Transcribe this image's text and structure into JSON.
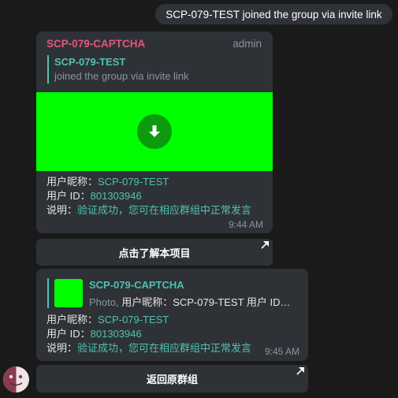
{
  "service_message": "SCP-079-TEST joined the group via invite link",
  "message1": {
    "sender": "SCP-079-CAPTCHA",
    "role": "admin",
    "quote_title": "SCP-079-TEST",
    "quote_subtitle": "joined the group via invite link",
    "line1_label": "用户昵称：",
    "line1_value": "SCP-079-TEST",
    "line2_label": "用户 ID：",
    "line2_value": "801303946",
    "line3_label": "说明：",
    "line3_value": "验证成功，您可在相应群组中正常发言",
    "time": "9:44 AM",
    "media_color": "#00ff00"
  },
  "keyboard1": {
    "button_label": "点击了解本项目"
  },
  "message2": {
    "reply_title": "SCP-079-CAPTCHA",
    "reply_kind": "Photo,",
    "reply_snippet": " 用户昵称：SCP-079-TEST 用户 ID：…",
    "line1_label": "用户昵称：",
    "line1_value": "SCP-079-TEST",
    "line2_label": "用户 ID：",
    "line2_value": "801303946",
    "line3_label": "说明：",
    "line3_value": "验证成功，您可在相应群组中正常发言",
    "time": "9:45 AM"
  },
  "keyboard2": {
    "button_label": "返回原群组"
  },
  "colors": {
    "background": "#1a1a1a",
    "bubble": "#2e3237",
    "sender_name": "#e2567a",
    "accent": "#4fc2b0",
    "muted": "#8b939c"
  },
  "icons": {
    "download": "download-icon",
    "keyboard_link": "arrow-up-right-icon",
    "avatar": "avatar-icon"
  }
}
